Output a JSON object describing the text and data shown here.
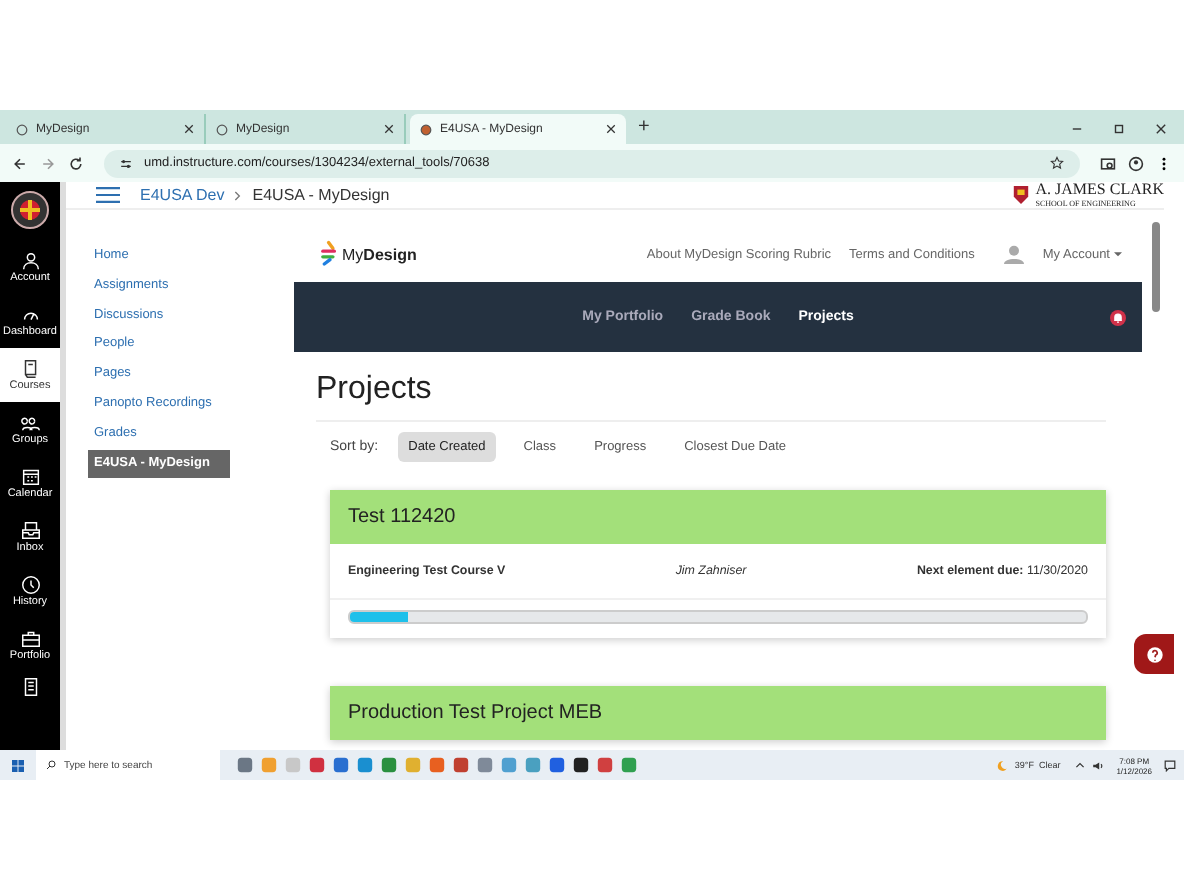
{
  "browser": {
    "tabs": [
      {
        "title": "MyDesign",
        "selected": false
      },
      {
        "title": "MyDesign",
        "selected": false
      },
      {
        "title": "E4USA - MyDesign",
        "selected": true
      }
    ],
    "new_tab": "+",
    "url": "umd.instructure.com/courses/1304234/external_tools/70638"
  },
  "global_nav": [
    {
      "label": "Account",
      "selected": false
    },
    {
      "label": "Dashboard",
      "selected": false
    },
    {
      "label": "Courses",
      "selected": true
    },
    {
      "label": "Groups",
      "selected": false
    },
    {
      "label": "Calendar",
      "selected": false
    },
    {
      "label": "Inbox",
      "selected": false
    },
    {
      "label": "History",
      "selected": false
    },
    {
      "label": "Portfolio",
      "selected": false
    }
  ],
  "breadcrumb": [
    "E4USA Dev",
    "E4USA - MyDesign"
  ],
  "school_logo": {
    "line1": "A. JAMES CLARK",
    "line2": "SCHOOL OF ENGINEERING"
  },
  "course_nav": [
    {
      "label": "Home",
      "selected": false
    },
    {
      "label": "Assignments",
      "selected": false
    },
    {
      "label": "Discussions",
      "selected": false
    },
    {
      "label": "People",
      "selected": false
    },
    {
      "label": "Pages",
      "selected": false
    },
    {
      "label": "Panopto Recordings",
      "selected": false
    },
    {
      "label": "Grades",
      "selected": false
    },
    {
      "label": "E4USA - MyDesign",
      "selected": true
    }
  ],
  "mydesign": {
    "logo": "My**Design**",
    "header_links": [
      "About MyDesign Scoring Rubric",
      "Terms and Conditions"
    ],
    "account": "My Account",
    "nav": [
      {
        "label": "My Portfolio",
        "selected": false
      },
      {
        "label": "Grade Book",
        "selected": false
      },
      {
        "label": "Projects",
        "selected": true
      }
    ],
    "title": "Projects",
    "sort_label": "Sort by:",
    "sort_options": [
      {
        "label": "Date Created",
        "selected": true
      },
      {
        "label": "Class",
        "selected": false
      },
      {
        "label": "Progress",
        "selected": false
      },
      {
        "label": "Closest Due Date",
        "selected": false
      }
    ],
    "projects": [
      {
        "title": "Test 112420",
        "course": "Engineering Test Course V",
        "teacher": "Jim Zahniser",
        "due_label": "Next element due:",
        "due_date": "11/30/2020",
        "level": 0.08
      },
      {
        "title": "Production Test Project MEB"
      }
    ]
  },
  "taskbar": {
    "search_placeholder": "Type here to search",
    "weather": "39°F  Clear",
    "time": "7:08 PM",
    "date": "1/12/2026"
  }
}
